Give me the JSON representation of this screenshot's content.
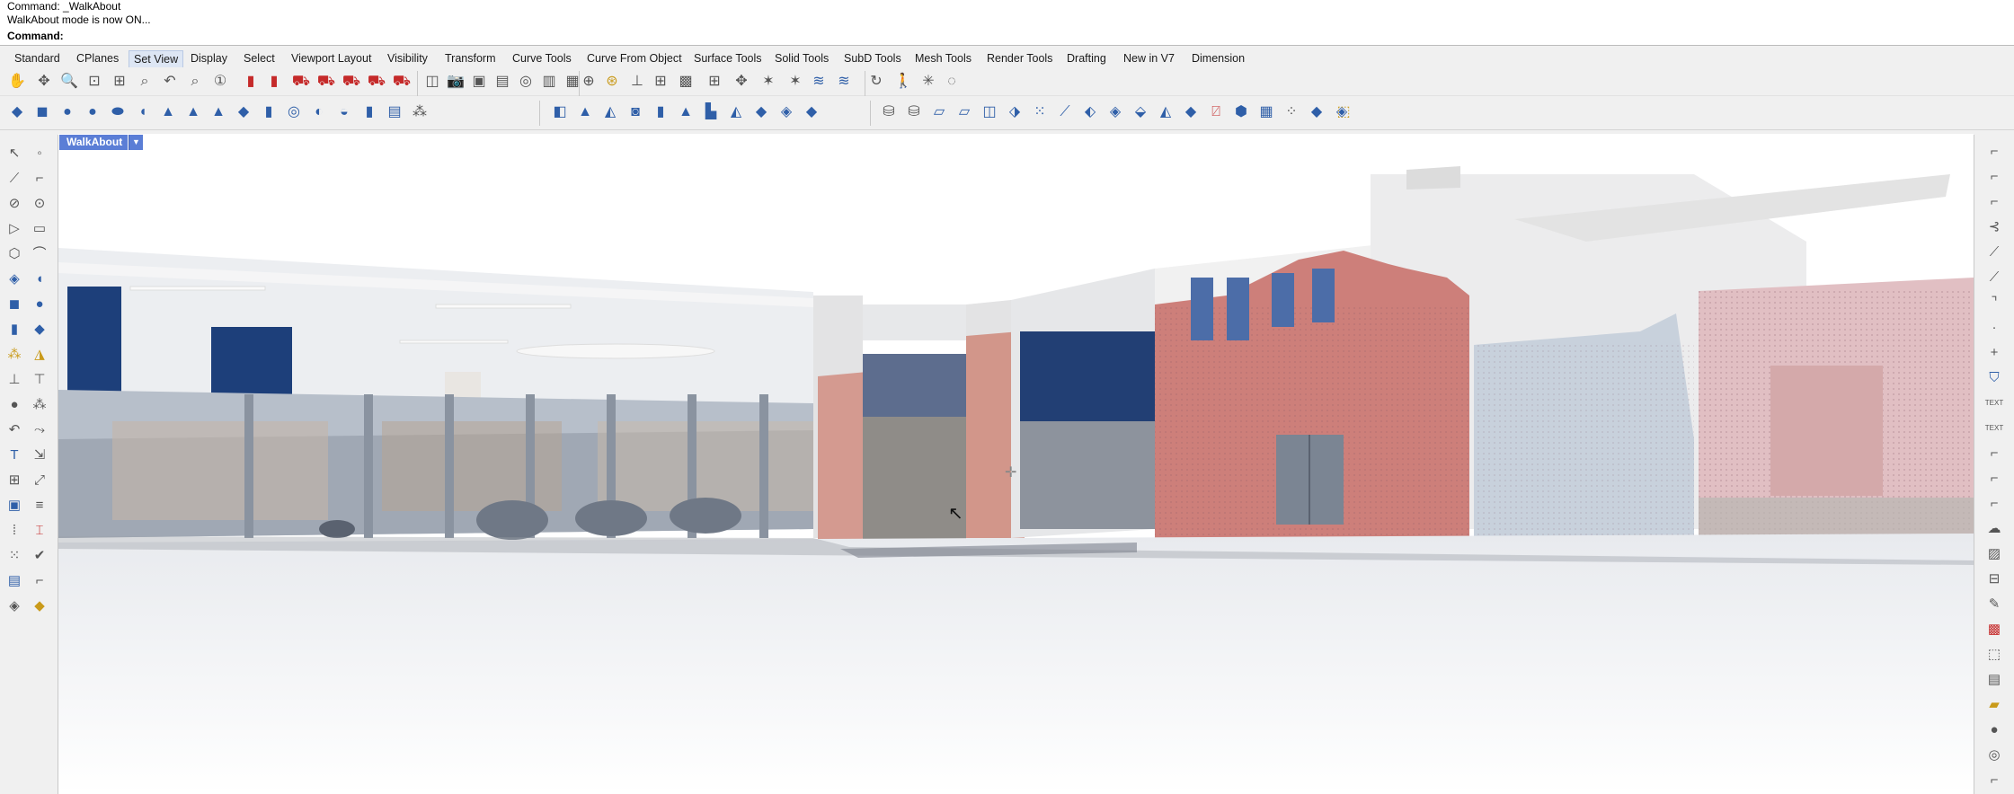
{
  "command_history": {
    "line1": "Command: _WalkAbout",
    "line2": "WalkAbout mode is now ON..."
  },
  "command_prompt": {
    "label": "Command:",
    "value": ""
  },
  "toolbar_tabs": [
    {
      "label": "Standard"
    },
    {
      "label": "CPlanes"
    },
    {
      "label": "Set View",
      "active": true
    },
    {
      "label": "Display"
    },
    {
      "label": "Select"
    },
    {
      "label": "Viewport Layout"
    },
    {
      "label": "Visibility"
    },
    {
      "label": "Transform"
    },
    {
      "label": "Curve Tools"
    },
    {
      "label": "Curve From Object"
    },
    {
      "label": "Surface Tools"
    },
    {
      "label": "Solid Tools"
    },
    {
      "label": "SubD Tools"
    },
    {
      "label": "Mesh Tools"
    },
    {
      "label": "Render Tools"
    },
    {
      "label": "Drafting"
    },
    {
      "label": "New in V7"
    },
    {
      "label": "Dimension"
    }
  ],
  "set_view_toolbar": {
    "icons": [
      "pan-icon",
      "rotate-view-icon",
      "zoom-dynamic-icon",
      "zoom-window-icon",
      "zoom-extents-icon",
      "zoom-selected-icon",
      "undo-view-icon",
      "zoom-target-icon",
      "zoom-1-to-1-icon",
      "camera-red-icon",
      "camera-dark-red-icon",
      "car-icon",
      "car-icon",
      "car-icon",
      "car-icon",
      "car-icon",
      "camera-icon",
      "named-view-icon",
      "named-view-icon",
      "set-camera-icon",
      "match-view-icon",
      "viewport-properties-icon",
      "grid-icon",
      "sphere-icon",
      "target-icon",
      "target-yellow-icon",
      "place-camera-icon",
      "lens-icon",
      "parallel-view-icon",
      "perspective-view-icon",
      "rotate-camera-icon",
      "tilt-view-icon",
      "swivel-icon",
      "roll-icon",
      "orbit-icon",
      "walkabout-icon",
      "twist-icon",
      "circle-icon"
    ]
  },
  "mesh_toolbar": {
    "icons": [
      "mesh-box-icon",
      "mesh-cylinder-icon",
      "mesh-sphere-icon",
      "mesh-sphere-icon",
      "mesh-ellipsoid-icon",
      "mesh-disk-icon",
      "mesh-cone-icon",
      "mesh-cone-icon",
      "mesh-pyramid-icon",
      "mesh-plane-icon",
      "mesh-cylinder-icon",
      "mesh-torus-icon",
      "mesh-patch-icon",
      "mesh-pipe-icon",
      "mesh-tube-icon",
      "mesh-layers-icon",
      "mesh-network-icon",
      "mesh-face-icon",
      "mesh-cone-face-icon",
      "mesh-pyramid-icon",
      "mesh-rounded-icon",
      "mesh-tube-icon",
      "mesh-cone-icon",
      "mesh-cylinder-icon",
      "mesh-slab-icon",
      "mesh-fold-icon",
      "mesh-cloud-icon",
      "mesh-stack-icon",
      "mesh-stack-icon",
      "mesh-plane-icon",
      "mesh-plane-icon",
      "mesh-box-icon",
      "mesh-box-icon",
      "mesh-points-icon",
      "mesh-repair-icon",
      "mesh-cut-icon",
      "mesh-cut-icon",
      "mesh-subdivide-icon",
      "mesh-wrap-icon",
      "mesh-grid-icon",
      "mesh-curve-icon",
      "mesh-curve-icon",
      "mesh-mirror-icon",
      "mesh-grid-icon",
      "mesh-points-icon",
      "mesh-box-icon",
      "mesh-shell-icon"
    ]
  },
  "viewport": {
    "tab_label": "WalkAbout"
  },
  "left_sidebar_icons": [
    "select-arrow-icon",
    "point-icon",
    "polyline-icon",
    "line-icon",
    "circle-icon",
    "circle-edit-icon",
    "triangle-icon",
    "rectangle-icon",
    "polygon-icon",
    "curve-icon",
    "transform-icon",
    "fillet-icon",
    "box-icon",
    "sphere-icon",
    "cylinder-icon",
    "surface-icon",
    "pipe-icon",
    "fold-icon",
    "extend-icon",
    "fillet-edge-icon",
    "boolean-icon",
    "shell-icon",
    "rotate-icon",
    "curve-through-icon",
    "text-icon",
    "mirror-icon",
    "array-icon",
    "scale-icon",
    "pattern-icon",
    "extrude-icon",
    "distance-icon",
    "dimension-icon",
    "grid-array-icon",
    "point-cloud-icon",
    "fit-icon",
    "edit-icon",
    "bend-icon",
    "shape-icon"
  ],
  "right_sidebar_icons": [
    "dim-corner-icon",
    "dim-corner-icon",
    "dim-angle-icon",
    "dim-radius-icon",
    "dim-diameter-icon",
    "dim-arc-icon",
    "dim-extend-icon",
    "point-icon",
    "plus-icon",
    "shield-icon",
    "text-icon",
    "text-icon",
    "leader-icon",
    "leader-icon",
    "leader-icon",
    "cloud-icon",
    "hatch-icon",
    "section-icon",
    "edit-dim-icon",
    "color-icon",
    "box-icon",
    "table-icon",
    "folder-icon",
    "ball-icon",
    "spiral-icon",
    "dim-end-icon"
  ]
}
